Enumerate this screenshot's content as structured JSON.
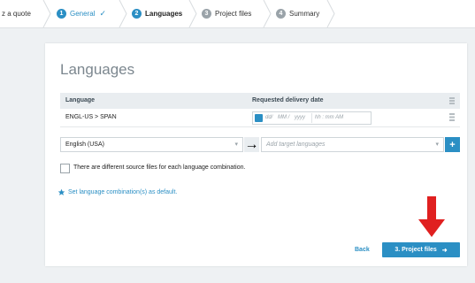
{
  "steps": [
    {
      "label": "z a quote",
      "num": ""
    },
    {
      "label": "General",
      "num": "1",
      "state": "done",
      "check": "✓"
    },
    {
      "label": "Languages",
      "num": "2",
      "state": "active"
    },
    {
      "label": "Project files",
      "num": "3",
      "state": "todo"
    },
    {
      "label": "Summary",
      "num": "4",
      "state": "todo"
    }
  ],
  "card": {
    "title": "Languages",
    "table": {
      "col_language": "Language",
      "col_date": "Requested delivery date",
      "row": {
        "language": "ENGL-US > SPAN",
        "date_placeholders": [
          "dd/",
          "MM /",
          "yyyy",
          "hh : mm AM"
        ]
      }
    },
    "source_select": {
      "value": "English (USA)"
    },
    "arrow": "→",
    "target_select": {
      "placeholder": "Add target languages"
    },
    "add_button": "+",
    "checkbox_label": "There are different source files for each language combination.",
    "default_link": "Set language combination(s) as default.",
    "back_label": "Back",
    "next_label": "3. Project files",
    "next_arrow": "➜"
  },
  "colors": {
    "accent": "#2b8fc4",
    "annotation": "#e02020"
  }
}
